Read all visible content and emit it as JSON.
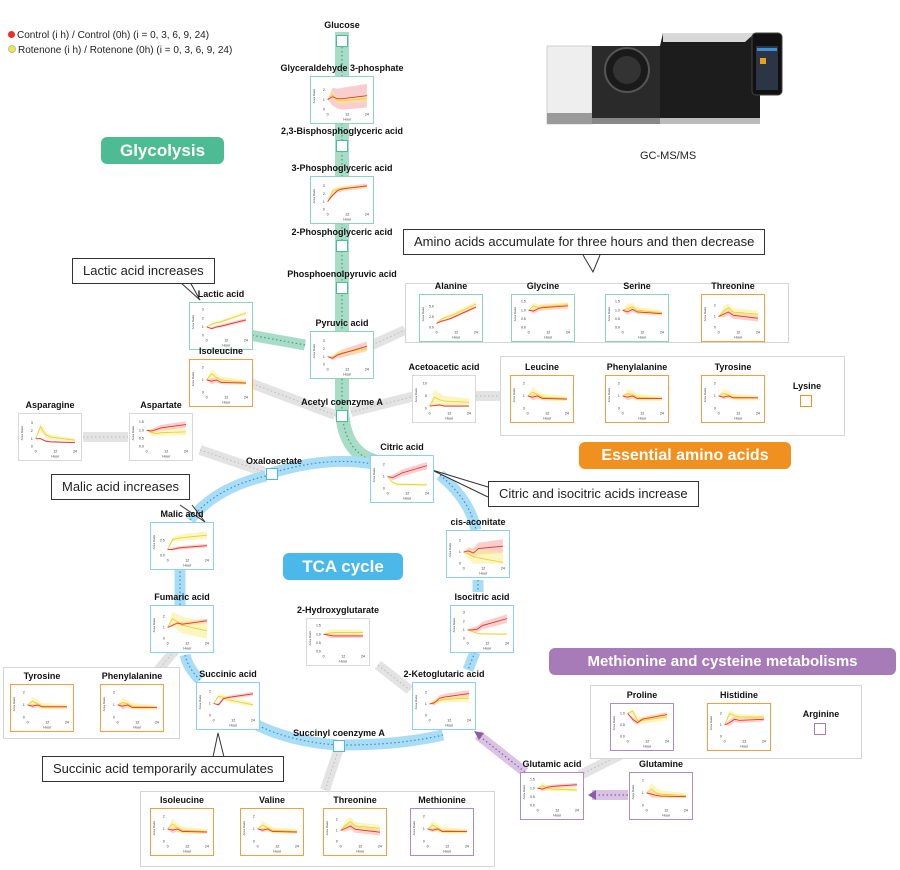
{
  "legend": {
    "control": {
      "label": "Control (i h) / Control (0h) (i = 0, 3, 6, 9, 24)",
      "color": "#e8302a"
    },
    "rotenone": {
      "label": "Rotenone (i h) / Rotenone (0h)  (i = 0, 3, 6, 9, 24)",
      "color": "#f2e83a"
    }
  },
  "pathways": {
    "glycolysis": {
      "label": "Glycolysis",
      "color": "#4dbb94"
    },
    "tca": {
      "label": "TCA cycle",
      "color": "#4ab8e8"
    },
    "essential": {
      "label": "Essential amino acids",
      "color": "#f0901e"
    },
    "methionine": {
      "label": "Methionine and cysteine metabolisms",
      "color": "#a77ab8"
    }
  },
  "instrument": {
    "label": "GC-MS/MS"
  },
  "callouts": {
    "lactic": "Lactic acid increases",
    "amino": "Amino acids accumulate for three hours and then decrease",
    "malic": "Malic acid increases",
    "citric": "Citric and isocitric acids increase",
    "succinic": "Succinic acid temporarily accumulates"
  },
  "axis": {
    "xlabel": "Hour",
    "ylabel": "Area Ratio",
    "xticks": [
      "0",
      "12",
      "24"
    ]
  },
  "plain_nodes": {
    "glucose": "Glucose",
    "bpg": "2,3-Bisphosphoglyceric acid",
    "pg2": "2-Phosphoglyceric acid",
    "pep": "Phosphoenolpyruvic acid",
    "acetylcoa": "Acetyl coenzyme A",
    "oxaloacetate": "Oxaloacetate",
    "succinylcoa": "Succinyl coenzyme A",
    "lysine": "Lysine",
    "arginine": "Arginine"
  },
  "metabolites": [
    {
      "id": "g3p",
      "name": "Glyceraldehyde 3-phosphate",
      "group": "glycolysis",
      "yticks": [
        "0",
        "1",
        "2"
      ],
      "ymax": 2.8,
      "control": [
        1,
        1.3,
        1.1,
        1.1,
        1.4
      ],
      "rotenone": [
        1,
        1.5,
        0.9,
        0.9,
        1.1
      ],
      "cband": [
        0.8,
        1.2
      ],
      "rband": [
        0.3,
        0.3
      ]
    },
    {
      "id": "pg3",
      "name": "3-Phosphoglyceric acid",
      "group": "glycolysis",
      "yticks": [
        "0",
        "1",
        "2",
        "3"
      ],
      "ymax": 3.5,
      "control": [
        1,
        1.8,
        2.4,
        2.6,
        3.0
      ],
      "rotenone": [
        1,
        2.3,
        2.6,
        2.7,
        2.9
      ],
      "cband": [
        0.2,
        0.3
      ],
      "rband": [
        0.4,
        0.2
      ]
    },
    {
      "id": "pyruvic",
      "name": "Pyruvic acid",
      "group": "glycolysis",
      "yticks": [
        "0",
        "1",
        "2",
        "3"
      ],
      "ymax": 3.5,
      "control": [
        1,
        0.8,
        1.2,
        1.4,
        2.3
      ],
      "rotenone": [
        1,
        0.9,
        1.3,
        1.5,
        2.0
      ],
      "cband": [
        0.2,
        0.6
      ],
      "rband": [
        0.2,
        0.3
      ]
    },
    {
      "id": "lactic",
      "name": "Lactic acid",
      "group": "glycolysis",
      "yticks": [
        "0",
        "1",
        "2",
        "3"
      ],
      "ymax": 3.2,
      "control": [
        1,
        0.8,
        1.0,
        1.1,
        1.8
      ],
      "rotenone": [
        1,
        1.3,
        1.5,
        1.6,
        2.6
      ],
      "cband": [
        0.1,
        0.2
      ],
      "rband": [
        0.1,
        0.2
      ]
    },
    {
      "id": "alanine",
      "name": "Alanine",
      "group": "glycolysis",
      "yticks": [
        "0.0",
        "2.5",
        "5.0"
      ],
      "ymax": 6.5,
      "control": [
        1,
        1.5,
        1.8,
        2.2,
        4.8
      ],
      "rotenone": [
        1,
        2.0,
        2.5,
        2.8,
        5.5
      ],
      "cband": [
        0.2,
        0.3
      ],
      "rband": [
        0.3,
        0.6
      ]
    },
    {
      "id": "glycine",
      "name": "Glycine",
      "group": "glycolysis",
      "yticks": [
        "0.0",
        "0.5",
        "1.0",
        "1.5"
      ],
      "ymax": 1.6,
      "control": [
        1,
        0.95,
        1.1,
        1.15,
        1.25
      ],
      "rotenone": [
        1,
        1.25,
        1.15,
        1.2,
        1.3
      ],
      "cband": [
        0.15,
        0.15
      ],
      "rband": [
        0.2,
        0.15
      ]
    },
    {
      "id": "serine",
      "name": "Serine",
      "group": "glycolysis",
      "yticks": [
        "0.0",
        "0.5",
        "1.0",
        "1.5"
      ],
      "ymax": 1.6,
      "control": [
        1,
        0.9,
        1.05,
        0.9,
        0.8
      ],
      "rotenone": [
        1,
        1.1,
        1.2,
        1.0,
        0.85
      ],
      "cband": [
        0.2,
        0.1
      ],
      "rband": [
        0.3,
        0.15
      ]
    },
    {
      "id": "threonine_top",
      "name": "Threonine",
      "group": "essential",
      "yticks": [
        "0",
        "1",
        "2"
      ],
      "ymax": 2.5,
      "control": [
        1,
        1.2,
        1.4,
        1.1,
        0.85
      ],
      "rotenone": [
        1,
        1.5,
        1.8,
        1.4,
        1.2
      ],
      "cband": [
        0.3,
        0.3
      ],
      "rband": [
        0.5,
        0.3
      ]
    },
    {
      "id": "isoleucine_top",
      "name": "Isoleucine",
      "group": "essential",
      "yticks": [
        "0",
        "1",
        "2"
      ],
      "ymax": 2.2,
      "control": [
        1,
        0.9,
        1.0,
        0.8,
        0.75
      ],
      "rotenone": [
        1,
        1.5,
        1.2,
        1.0,
        0.8
      ],
      "cband": [
        0.3,
        0.1
      ],
      "rband": [
        0.4,
        0.2
      ]
    },
    {
      "id": "acetoacetic",
      "name": "Acetoacetic acid",
      "group": "neutral",
      "yticks": [
        "0",
        "5",
        "10"
      ],
      "ymax": 11,
      "control": [
        1,
        1.2,
        1.5,
        1.0,
        1.0
      ],
      "rotenone": [
        1,
        4.5,
        3.5,
        3.0,
        2.5
      ],
      "cband": [
        0.3,
        0.3
      ],
      "rband": [
        3.5,
        1.5
      ]
    },
    {
      "id": "leucine",
      "name": "Leucine",
      "group": "essential",
      "yticks": [
        "0",
        "1",
        "2"
      ],
      "ymax": 2.2,
      "control": [
        1,
        0.9,
        1.0,
        0.8,
        0.75
      ],
      "rotenone": [
        1,
        1.3,
        1.1,
        0.9,
        0.8
      ],
      "cband": [
        0.3,
        0.1
      ],
      "rband": [
        0.4,
        0.2
      ]
    },
    {
      "id": "phenylalanine_top",
      "name": "Phenylalanine",
      "group": "essential",
      "yticks": [
        "0",
        "1",
        "2"
      ],
      "ymax": 2.2,
      "control": [
        1,
        0.9,
        1.0,
        0.8,
        0.8
      ],
      "rotenone": [
        1,
        1.2,
        1.1,
        0.9,
        0.8
      ],
      "cband": [
        0.3,
        0.1
      ],
      "rband": [
        0.4,
        0.2
      ]
    },
    {
      "id": "tyrosine_top",
      "name": "Tyrosine",
      "group": "essential",
      "yticks": [
        "0",
        "1",
        "2"
      ],
      "ymax": 2.2,
      "control": [
        1,
        0.9,
        1.0,
        0.85,
        0.85
      ],
      "rotenone": [
        1,
        1.2,
        1.1,
        0.9,
        0.85
      ],
      "cband": [
        0.2,
        0.1
      ],
      "rband": [
        0.4,
        0.2
      ]
    },
    {
      "id": "asparagine",
      "name": "Asparagine",
      "group": "neutral",
      "yticks": [
        "0",
        "1",
        "2",
        "3"
      ],
      "ymax": 3.5,
      "control": [
        1,
        1.0,
        0.7,
        0.6,
        0.5
      ],
      "rotenone": [
        1,
        2.5,
        1.5,
        1.2,
        0.8
      ],
      "cband": [
        0.1,
        0.1
      ],
      "rband": [
        0.6,
        0.2
      ]
    },
    {
      "id": "aspartate",
      "name": "Aspartate",
      "group": "neutral",
      "yticks": [
        "0.0",
        "0.5",
        "1.0",
        "1.5"
      ],
      "ymax": 1.7,
      "control": [
        1,
        0.95,
        1.05,
        1.15,
        1.35
      ],
      "rotenone": [
        1,
        0.85,
        0.8,
        0.85,
        0.9
      ],
      "cband": [
        0.1,
        0.2
      ],
      "rband": [
        0.15,
        0.2
      ]
    },
    {
      "id": "citric",
      "name": "Citric acid",
      "group": "tca",
      "yticks": [
        "0",
        "1",
        "2"
      ],
      "ymax": 2.3,
      "control": [
        1,
        0.9,
        1.1,
        1.3,
        1.9
      ],
      "rotenone": [
        1,
        0.5,
        0.35,
        0.35,
        0.3
      ],
      "cband": [
        0.2,
        0.3
      ],
      "rband": [
        0.1,
        0.1
      ]
    },
    {
      "id": "malic",
      "name": "Malic acid",
      "group": "tca",
      "yticks": [
        "0.0",
        "2.5"
      ],
      "ymax": 4.5,
      "control": [
        1,
        1.0,
        1.2,
        1.3,
        1.6
      ],
      "rotenone": [
        1,
        2.6,
        2.8,
        2.9,
        3.3
      ],
      "cband": [
        0.2,
        0.3
      ],
      "rband": [
        0.3,
        0.6
      ]
    },
    {
      "id": "cisaconitate",
      "name": "cis-aconitate",
      "group": "tca",
      "yticks": [
        "0",
        "1",
        "2"
      ],
      "ymax": 2.4,
      "control": [
        1,
        1.1,
        0.9,
        1.3,
        1.5
      ],
      "rotenone": [
        1,
        0.8,
        0.6,
        0.5,
        0.1
      ],
      "cband": [
        0.2,
        0.6
      ],
      "rband": [
        0.3,
        0.9
      ]
    },
    {
      "id": "fumaric",
      "name": "Fumaric acid",
      "group": "tca",
      "yticks": [
        "0",
        "1",
        "2"
      ],
      "ymax": 2.5,
      "control": [
        1,
        1.2,
        1.4,
        1.3,
        1.6
      ],
      "rotenone": [
        1,
        1.8,
        1.5,
        1.2,
        0.7
      ],
      "cband": [
        0.1,
        0.2
      ],
      "rband": [
        0.6,
        0.8
      ]
    },
    {
      "id": "hydroxyglutarate",
      "name": "2-Hydroxyglutarate",
      "group": "neutral",
      "yticks": [
        "0.0",
        "0.5",
        "1.0",
        "1.5"
      ],
      "ymax": 1.6,
      "control": [
        1,
        0.95,
        0.9,
        0.9,
        0.9
      ],
      "rotenone": [
        1,
        1.05,
        1.1,
        1.1,
        1.1
      ],
      "cband": [
        0.15,
        0.1
      ],
      "rband": [
        0.2,
        0.15
      ]
    },
    {
      "id": "isocitric",
      "name": "Isocitric acid",
      "group": "tca",
      "yticks": [
        "0",
        "1",
        "2",
        "3"
      ],
      "ymax": 3.2,
      "control": [
        1,
        1.0,
        1.1,
        1.5,
        2.3
      ],
      "rotenone": [
        1,
        0.8,
        0.6,
        0.55,
        0.5
      ],
      "cband": [
        0.2,
        0.5
      ],
      "rband": [
        0.1,
        0.1
      ]
    },
    {
      "id": "succinic",
      "name": "Succinic acid",
      "group": "tca",
      "yticks": [
        "0",
        "1",
        "2"
      ],
      "ymax": 2.3,
      "control": [
        1,
        0.9,
        1.4,
        1.5,
        1.8
      ],
      "rotenone": [
        1,
        1.6,
        1.5,
        1.3,
        0.9
      ],
      "cband": [
        0.1,
        0.15
      ],
      "rband": [
        0.2,
        0.2
      ]
    },
    {
      "id": "ketoglutaric",
      "name": "2-Ketoglutaric acid",
      "group": "tca",
      "yticks": [
        "0",
        "1",
        "2"
      ],
      "ymax": 2.4,
      "control": [
        1,
        1.1,
        1.5,
        1.6,
        1.9
      ],
      "rotenone": [
        1,
        1.2,
        1.3,
        1.4,
        1.5
      ],
      "cband": [
        0.2,
        0.3
      ],
      "rband": [
        0.2,
        0.3
      ]
    },
    {
      "id": "tyrosine_left",
      "name": "Tyrosine",
      "group": "essential",
      "yticks": [
        "0",
        "1",
        "2"
      ],
      "ymax": 2.2,
      "control": [
        1,
        0.9,
        1.0,
        0.85,
        0.85
      ],
      "rotenone": [
        1,
        1.3,
        1.1,
        0.9,
        0.85
      ],
      "cband": [
        0.2,
        0.1
      ],
      "rband": [
        0.4,
        0.2
      ]
    },
    {
      "id": "phenylalanine_left",
      "name": "Phenylalanine",
      "group": "essential",
      "yticks": [
        "0",
        "1",
        "2"
      ],
      "ymax": 2.2,
      "control": [
        1,
        0.9,
        1.0,
        0.8,
        0.8
      ],
      "rotenone": [
        1,
        1.2,
        1.1,
        0.9,
        0.8
      ],
      "cband": [
        0.3,
        0.1
      ],
      "rband": [
        0.4,
        0.2
      ]
    },
    {
      "id": "proline",
      "name": "Proline",
      "group": "methionine",
      "yticks": [
        "0.0",
        "0.5",
        "1.0"
      ],
      "ymax": 1.2,
      "control": [
        1,
        0.75,
        0.6,
        0.75,
        0.95
      ],
      "rotenone": [
        1,
        1.1,
        0.7,
        0.7,
        0.85
      ],
      "cband": [
        0.1,
        0.1
      ],
      "rband": [
        0.15,
        0.15
      ]
    },
    {
      "id": "histidine",
      "name": "Histidine",
      "group": "essential",
      "yticks": [
        "0",
        "1",
        "2"
      ],
      "ymax": 2.4,
      "control": [
        1,
        1.2,
        1.5,
        1.4,
        1.5
      ],
      "rotenone": [
        1,
        2.0,
        1.8,
        1.7,
        1.7
      ],
      "cband": [
        0.3,
        0.2
      ],
      "rband": [
        0.3,
        0.2
      ]
    },
    {
      "id": "glutamic",
      "name": "Glutamic acid",
      "group": "methionine",
      "yticks": [
        "0.0",
        "0.5",
        "1.0",
        "1.5"
      ],
      "ymax": 1.6,
      "control": [
        1,
        0.95,
        1.05,
        1.1,
        1.2
      ],
      "rotenone": [
        1,
        1.15,
        1.0,
        0.95,
        0.9
      ],
      "cband": [
        0.15,
        0.1
      ],
      "rband": [
        0.2,
        0.1
      ]
    },
    {
      "id": "glutamine",
      "name": "Glutamine",
      "group": "methionine",
      "yticks": [
        "0",
        "1",
        "2"
      ],
      "ymax": 2.2,
      "control": [
        1,
        0.9,
        0.8,
        0.75,
        0.7
      ],
      "rotenone": [
        1,
        1.3,
        1.0,
        0.9,
        0.8
      ],
      "cband": [
        0.3,
        0.1
      ],
      "rband": [
        0.6,
        0.2
      ]
    },
    {
      "id": "isoleucine_bot",
      "name": "Isoleucine",
      "group": "essential",
      "yticks": [
        "0",
        "1",
        "2"
      ],
      "ymax": 2.2,
      "control": [
        1,
        0.9,
        1.0,
        0.8,
        0.75
      ],
      "rotenone": [
        1,
        1.4,
        1.1,
        0.9,
        0.8
      ],
      "cband": [
        0.3,
        0.1
      ],
      "rband": [
        0.5,
        0.2
      ]
    },
    {
      "id": "valine",
      "name": "Valine",
      "group": "essential",
      "yticks": [
        "0",
        "1",
        "2"
      ],
      "ymax": 2.2,
      "control": [
        1,
        0.9,
        1.0,
        0.8,
        0.75
      ],
      "rotenone": [
        1,
        1.3,
        1.1,
        0.9,
        0.8
      ],
      "cband": [
        0.2,
        0.1
      ],
      "rband": [
        0.4,
        0.2
      ]
    },
    {
      "id": "threonine_bot",
      "name": "Threonine",
      "group": "essential",
      "yticks": [
        "0",
        "1",
        "2"
      ],
      "ymax": 2.5,
      "control": [
        1,
        1.2,
        1.4,
        1.1,
        0.85
      ],
      "rotenone": [
        1,
        1.5,
        1.8,
        1.4,
        1.2
      ],
      "cband": [
        0.3,
        0.3
      ],
      "rband": [
        0.5,
        0.3
      ]
    },
    {
      "id": "methionine",
      "name": "Methionine",
      "group": "methionine",
      "yticks": [
        "0",
        "1",
        "2"
      ],
      "ymax": 2.2,
      "control": [
        1,
        0.9,
        1.0,
        0.8,
        0.8
      ],
      "rotenone": [
        1,
        1.3,
        1.1,
        0.9,
        0.8
      ],
      "cband": [
        0.2,
        0.1
      ],
      "rband": [
        0.4,
        0.2
      ]
    }
  ],
  "hours": [
    0,
    3,
    6,
    9,
    24
  ]
}
